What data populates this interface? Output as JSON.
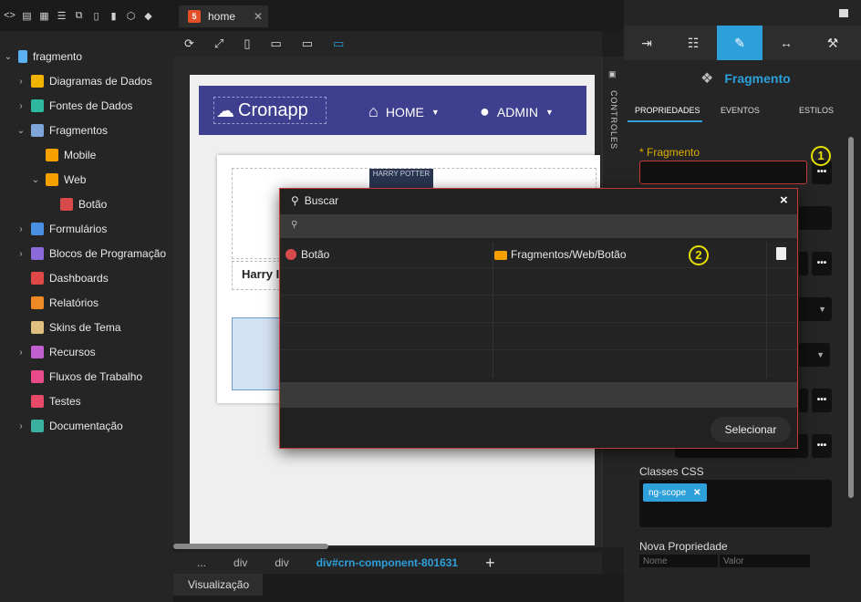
{
  "editor": {
    "tab_label": "home",
    "controls_label": "CONTROLES",
    "breadcrumb": [
      "...",
      "div",
      "div",
      "div#crn-component-801631"
    ],
    "bottom_tab": "Visualização"
  },
  "tree": {
    "root": "fragmento",
    "items": [
      {
        "label": "Diagramas de Dados",
        "icon": "diagram-icon",
        "color": "#f0b400"
      },
      {
        "label": "Fontes de Dados",
        "icon": "datasource-icon",
        "color": "#2fb8a0"
      },
      {
        "label": "Fragmentos",
        "icon": "fragments-icon",
        "color": "#7ea6d8"
      },
      {
        "label": "Mobile",
        "icon": "folder-icon",
        "color": "#f5a000"
      },
      {
        "label": "Web",
        "icon": "folder-icon",
        "color": "#f5a000"
      },
      {
        "label": "Botão",
        "icon": "fragment-file-icon",
        "color": "#d84a4a"
      },
      {
        "label": "Formulários",
        "icon": "forms-icon",
        "color": "#4a90e2"
      },
      {
        "label": "Blocos de Programação",
        "icon": "blocks-icon",
        "color": "#8a6ad8"
      },
      {
        "label": "Dashboards",
        "icon": "dashboards-icon",
        "color": "#e04848"
      },
      {
        "label": "Relatórios",
        "icon": "reports-icon",
        "color": "#f08a24"
      },
      {
        "label": "Skins de Tema",
        "icon": "palette-icon",
        "color": "#e0c080"
      },
      {
        "label": "Recursos",
        "icon": "resources-icon",
        "color": "#c060d0"
      },
      {
        "label": "Fluxos de Trabalho",
        "icon": "workflow-icon",
        "color": "#e84a8a"
      },
      {
        "label": "Testes",
        "icon": "tests-icon",
        "color": "#e84a6a"
      },
      {
        "label": "Documentação",
        "icon": "docs-icon",
        "color": "#3ab0a0"
      }
    ]
  },
  "preview": {
    "logo_text": "Cronapp",
    "nav_home": "HOME",
    "nav_admin": "ADMIN",
    "card_title": "Harry I",
    "book_text": "HARRY POTTER"
  },
  "panel": {
    "title": "Fragmento",
    "tabs": [
      "PROPRIEDADES",
      "EVENTOS",
      "ESTILOS"
    ],
    "fragment_label": "* Fragmento",
    "css_label": "Classes CSS",
    "css_tag": "ng-scope",
    "new_prop_label": "Nova Propriedade",
    "new_prop_name_ph": "Nome",
    "new_prop_value_ph": "Valor",
    "marker_1": "1"
  },
  "modal": {
    "title": "Buscar",
    "close": "×",
    "result_name": "Botão",
    "result_path": "Fragmentos/Web/Botão",
    "marker_2": "2",
    "select_button": "Selecionar"
  },
  "colors": {
    "accent": "#2d9fd9",
    "modal_border": "#c43a3a",
    "marker": "#e8e000",
    "navbar": "#3f3f8f"
  }
}
